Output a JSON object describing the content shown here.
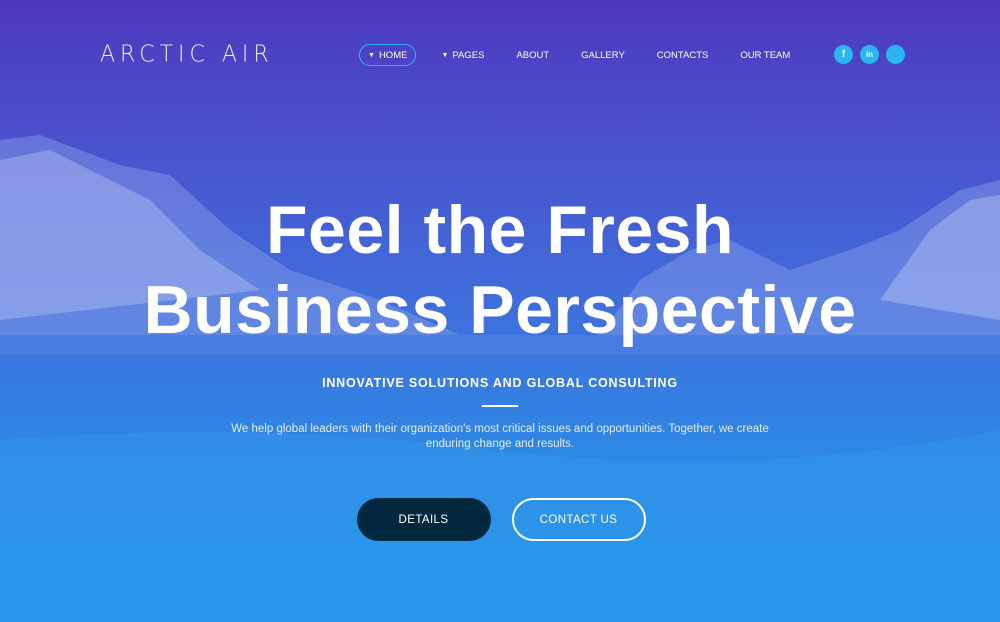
{
  "header": {
    "logo": "ARCTIC AIR",
    "nav": [
      {
        "label": "HOME",
        "dropdown": true,
        "active": true
      },
      {
        "label": "PAGES",
        "dropdown": true
      },
      {
        "label": "ABOUT"
      },
      {
        "label": "GALLERY"
      },
      {
        "label": "CONTACTS"
      },
      {
        "label": "OUR TEAM"
      }
    ],
    "social": [
      {
        "icon": "facebook-icon",
        "glyph": "f"
      },
      {
        "icon": "linkedin-icon",
        "glyph": "in"
      },
      {
        "icon": "twitter-icon",
        "glyph": "🐦"
      }
    ],
    "caret": "▼"
  },
  "hero": {
    "title_line1": "Feel the Fresh",
    "title_line2": "Business Perspective",
    "subtitle": "INNOVATIVE SOLUTIONS AND GLOBAL CONSULTING",
    "description": "We help global leaders with their organization's most critical issues and opportunities. Together, we create enduring change and results.",
    "primary_button": "DETAILS",
    "secondary_button": "CONTACT US"
  },
  "colors": {
    "accent": "#28b7f2",
    "dark_button": "#022840",
    "top": "#4d38bd",
    "bottom": "#1f96e8"
  }
}
